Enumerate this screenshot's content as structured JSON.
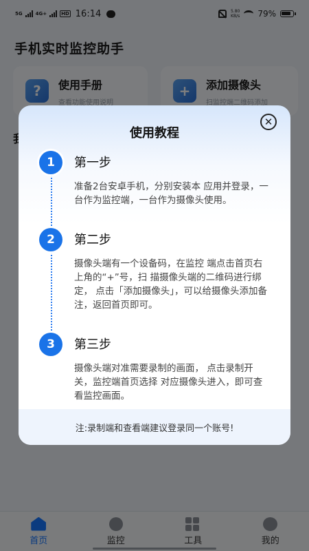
{
  "status_bar": {
    "network_top": "5G",
    "network_bottom": "4G+",
    "hd": "HD",
    "time": "16:14",
    "speed_value": "5.80",
    "speed_unit": "KB/s",
    "battery": "79%"
  },
  "app": {
    "title": "手机实时监控助手",
    "cards": [
      {
        "icon_char": "?",
        "icon": "manual-icon",
        "title": "使用手册",
        "subtitle": "查看功能使用说明"
      },
      {
        "icon_char": "+",
        "icon": "add-camera-icon",
        "title": "添加摄像头",
        "subtitle": "扫监控端二维码添加"
      }
    ],
    "section_peek": "我"
  },
  "modal": {
    "title": "使用教程",
    "close_symbol": "✕",
    "steps": [
      {
        "number": "1",
        "title": "第一步",
        "desc": "准备2台安卓手机，分别安装本 应用并登录，一台作为监控端，一台作为摄像头使用。"
      },
      {
        "number": "2",
        "title": "第二步",
        "desc": "摄像头端有一个设备码，在监控 端点击首页右上角的“+”号，扫 描摄像头端的二维码进行绑定， 点击「添加摄像头」，可以给摄像头添加备注，返回首页即可。"
      },
      {
        "number": "3",
        "title": "第三步",
        "desc": "摄像头端对准需要录制的画面， 点击录制开关，监控端首页选择 对应摄像头进入，即可查看监控画面。"
      }
    ],
    "footer_note": "注:录制端和查看端建议登录同一个账号!"
  },
  "tab_bar": {
    "tabs": [
      {
        "label": "首页",
        "icon": "home-icon",
        "active": true
      },
      {
        "label": "监控",
        "icon": "camera-icon",
        "active": false
      },
      {
        "label": "工具",
        "icon": "tools-icon",
        "active": false
      },
      {
        "label": "我的",
        "icon": "profile-icon",
        "active": false
      }
    ]
  },
  "colors": {
    "accent": "#1a73e8",
    "overlay": "rgba(0,0,0,0.5)",
    "footer_bg": "#eef4fd"
  }
}
